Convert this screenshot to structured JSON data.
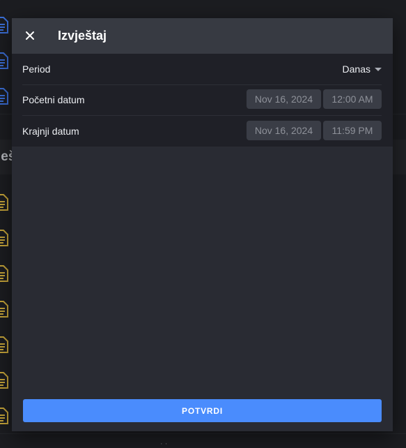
{
  "background": {
    "section_label": "ješ",
    "bottom_text": "· ·",
    "blue_icons": [
      "document-icon",
      "document-icon",
      "document-icon"
    ],
    "gold_icons": [
      "document-icon",
      "document-icon",
      "document-icon",
      "document-icon",
      "document-icon",
      "document-icon",
      "document-icon"
    ],
    "colors": {
      "blue_icon": "#3b6fd8",
      "gold_icon": "#c8a63a"
    }
  },
  "modal": {
    "title": "Izvještaj",
    "close_icon": "close-icon",
    "period": {
      "label": "Period",
      "value": "Danas"
    },
    "start": {
      "label": "Početni datum",
      "date": "Nov 16, 2024",
      "time": "12:00 AM"
    },
    "end": {
      "label": "Krajnji datum",
      "date": "Nov 16, 2024",
      "time": "11:59 PM"
    },
    "confirm_label": "POTVRDI",
    "colors": {
      "accent": "#4a8cfd",
      "header": "#373a42",
      "body": "#292b33"
    }
  }
}
